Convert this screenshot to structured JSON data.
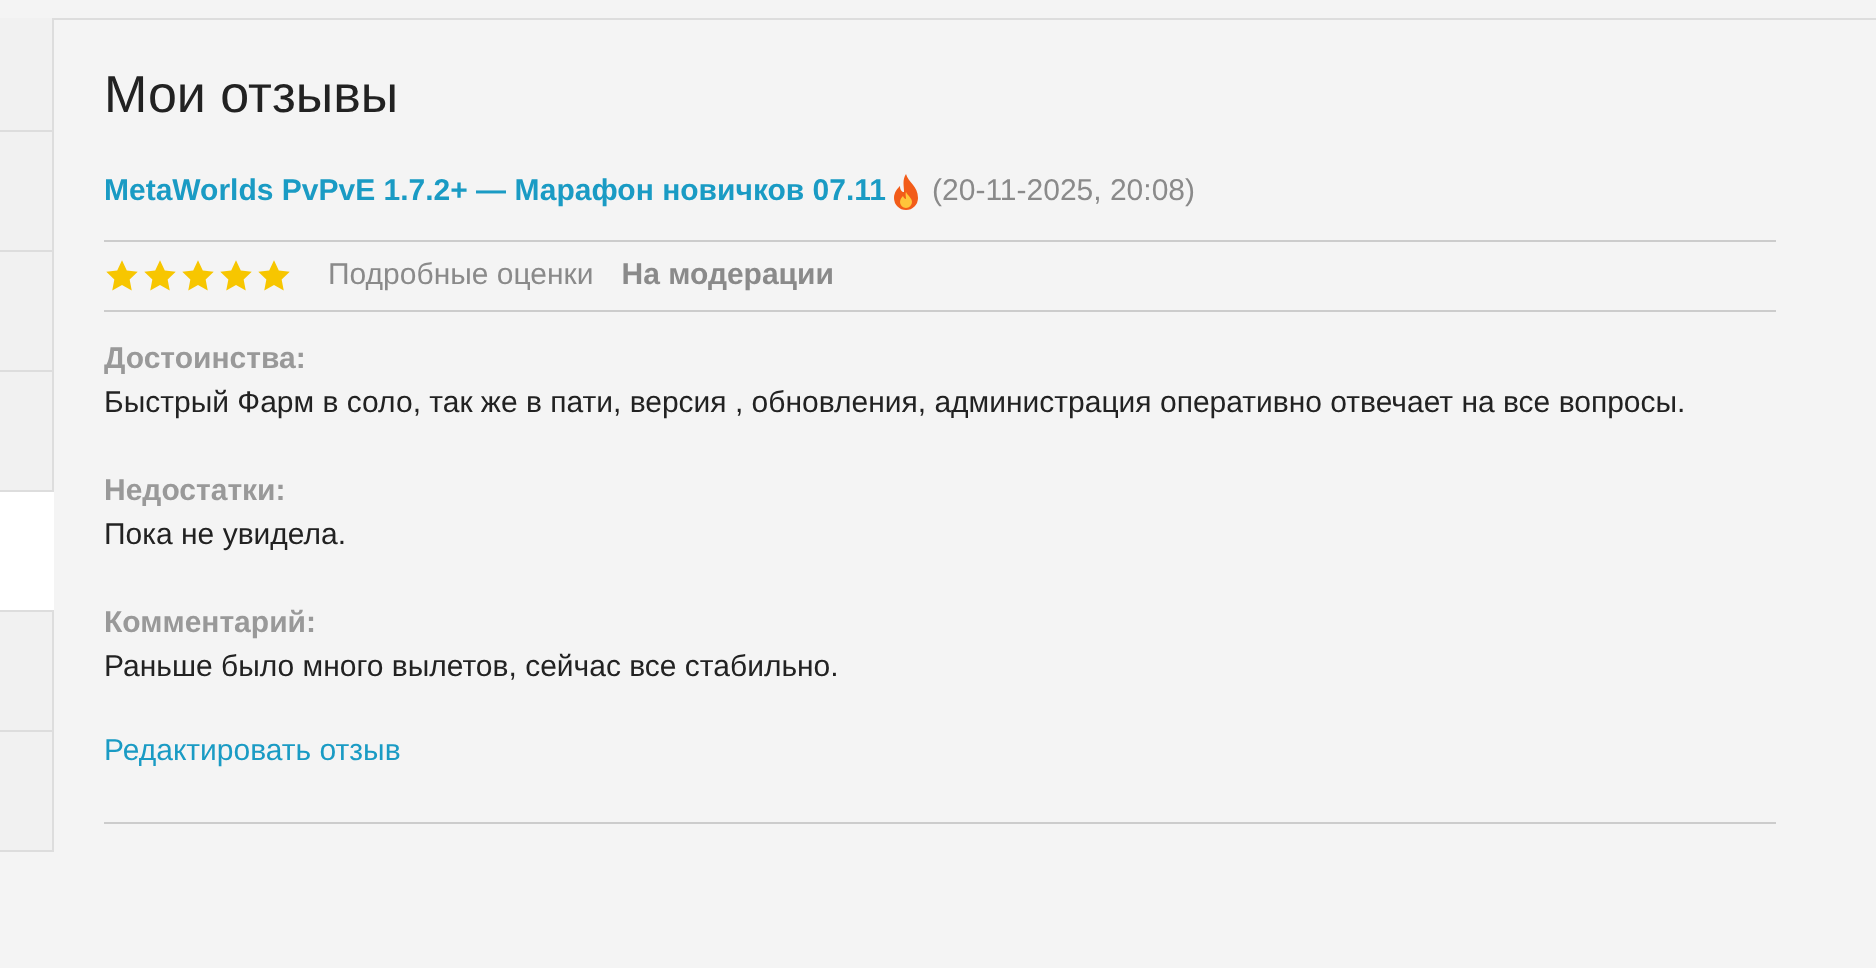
{
  "sidebar": {
    "items": [
      {
        "selected": false
      },
      {
        "selected": false
      },
      {
        "selected": false
      },
      {
        "selected": false
      },
      {
        "selected": true
      },
      {
        "selected": false
      },
      {
        "selected": false
      }
    ]
  },
  "page_title": "Мои отзывы",
  "review": {
    "title": "MetaWorlds PvPvE 1.7.2+ — Марафон новичков 07.11",
    "date": "(20-11-2025, 20:08)",
    "stars": 5,
    "details_link": "Подробные оценки",
    "status": "На модерации",
    "sections": [
      {
        "label": "Достоинства:",
        "text": "Быстрый Фарм в соло, так же в пати, версия , обновления, администрация оперативно отвечает на все вопросы."
      },
      {
        "label": "Недостатки:",
        "text": "Пока не увидела."
      },
      {
        "label": "Комментарий:",
        "text": "Раньше было много вылетов, сейчас все стабильно."
      }
    ],
    "edit_link": "Редактировать отзыв"
  }
}
